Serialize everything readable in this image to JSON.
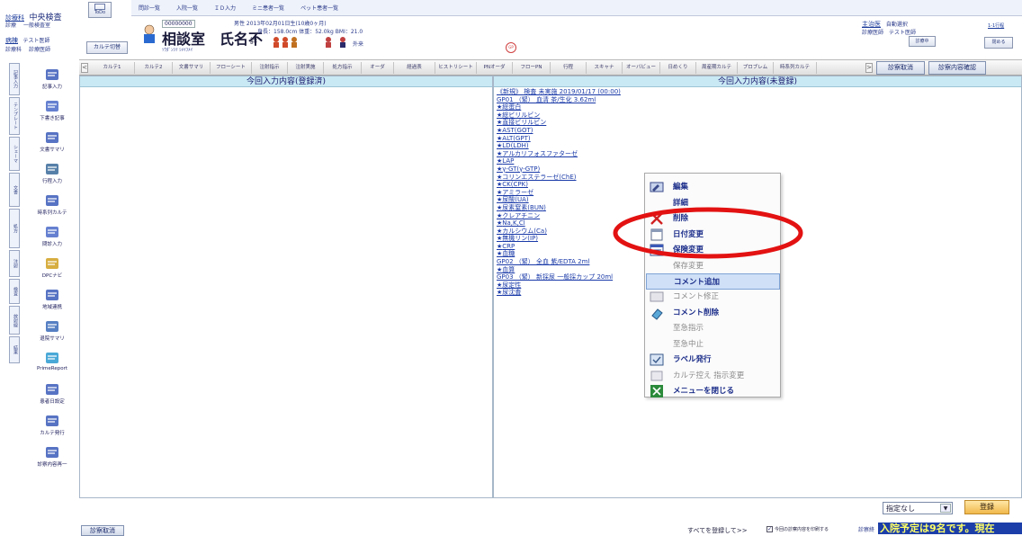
{
  "header": {
    "dept_label": "診療科",
    "dept_name": "中央検査",
    "dept_sub1": "診療",
    "dept_sub2": "一般検査室",
    "ward_label": "病棟",
    "ward_name": "テスト医師",
    "ward_sub": "診療科",
    "ward_sub2": "診療医師",
    "todo_label": "ToDo",
    "karte_switch": "カルテ切替",
    "menu_links": [
      "問診一覧",
      "入院一覧",
      "ＩＤ入力",
      "ミニ患者一覧",
      "ペット患者一覧"
    ],
    "attending_label": "主治医",
    "attending_value": "自動選択",
    "doctor_label": "診療医師",
    "doctor_value": "テスト医師",
    "link_right1": "1-1行程",
    "link_right2": "診療中",
    "link_right3": "閉める"
  },
  "patient": {
    "id": "00000000",
    "kana": "ｿｳﾀﾞﾝｼﾂ ｼﾒｲﾌﾒｲ",
    "name": "相談室　氏名不",
    "name_suffix": "詳",
    "info_line1": "男性 2013年02月01日生(10歳0ヶ月)",
    "info_line2": "身長：158.0cm  体重：52.0kg  BMI：21.0",
    "tag_inpatient": "外来"
  },
  "tabs": [
    "カルテ1",
    "カルテ2",
    "文書サマリ",
    "フローシート",
    "注射指示",
    "注射実施",
    "処方指示",
    "オーダ",
    "経過表",
    "ヒストリシート",
    "PNオーダ",
    "フローPN",
    "行程",
    "スキャナ",
    "オーバビュー",
    "日めくり",
    "周産期カルテ",
    "プロブレム",
    "時系列カルテ"
  ],
  "tab_buttons": {
    "cancel": "診察取消",
    "confirm": "診察内容確認"
  },
  "sidebar": {
    "vtabs": [
      "記事入力",
      "テンプレート",
      "シェーマ",
      "文書",
      "処方",
      "注射",
      "検査",
      "放射線",
      "結果"
    ],
    "items": [
      {
        "label": "記事入力",
        "icon": "pencil-icon"
      },
      {
        "label": "下書き記事",
        "icon": "draft-icon"
      },
      {
        "label": "文書サマリ",
        "icon": "document-icon"
      },
      {
        "label": "行程入力",
        "icon": "schedule-icon"
      },
      {
        "label": "時系列カルテ",
        "icon": "timeline-icon"
      },
      {
        "label": "問診入力",
        "icon": "interview-icon"
      },
      {
        "label": "DPCナビ",
        "icon": "dpc-icon"
      },
      {
        "label": "地域連携",
        "icon": "network-icon"
      },
      {
        "label": "退院サマリ",
        "icon": "summary-icon"
      },
      {
        "label": "PrimeReport",
        "icon": "report-icon"
      },
      {
        "label": "患者日設定",
        "icon": "calendar-icon"
      },
      {
        "label": "カルテ発行",
        "icon": "print-icon"
      },
      {
        "label": "診察内容再一",
        "icon": "review-icon"
      }
    ]
  },
  "panels": {
    "left_title": "今回入力内容(登録済)",
    "right_title": "今回入力内容(未登録)"
  },
  "order_list": [
    {
      "text": "《新規》 検査 未実施 2019/01/17 (00:00)",
      "star": false
    },
    {
      "text": "GP01 （緊） 血清 茶/生化 3.62ml",
      "star": false
    },
    {
      "text": "総蛋白",
      "star": true
    },
    {
      "text": "総ビリルビン",
      "star": true
    },
    {
      "text": "直接ビリルビン",
      "star": true
    },
    {
      "text": "AST(GOT)",
      "star": true
    },
    {
      "text": "ALT(GPT)",
      "star": true
    },
    {
      "text": "LD(LDH)",
      "star": true
    },
    {
      "text": "アルカリフォスファターゼ",
      "star": true
    },
    {
      "text": "LAP",
      "star": true
    },
    {
      "text": "γ-GT(γ-GTP)",
      "star": true
    },
    {
      "text": "コリンエステラーゼ(ChE)",
      "star": true
    },
    {
      "text": "CK(CPK)",
      "star": true
    },
    {
      "text": "アミラーゼ",
      "star": true
    },
    {
      "text": "尿酸(UA)",
      "star": true
    },
    {
      "text": "尿素窒素(BUN)",
      "star": true
    },
    {
      "text": "クレアチニン",
      "star": true
    },
    {
      "text": "Na,K,Cl",
      "star": true
    },
    {
      "text": "カルシウム(Ca)",
      "star": true
    },
    {
      "text": "無機リン(IP)",
      "star": true
    },
    {
      "text": "CRP",
      "star": true
    },
    {
      "text": "血糖",
      "star": true
    },
    {
      "text": "GP02 （緊） 全血 紫/EDTA 2ml",
      "star": false
    },
    {
      "text": "血算",
      "star": true
    },
    {
      "text": "GP03 （緊） 新採尿 一般採カップ 20ml",
      "star": false
    },
    {
      "text": "尿定性",
      "star": true
    },
    {
      "text": "尿沈査",
      "star": true
    }
  ],
  "context_menu": [
    {
      "label": "編集",
      "icon": "edit-icon",
      "enabled": true,
      "highlighted": false
    },
    {
      "label": "詳細",
      "icon": "",
      "enabled": true,
      "highlighted": false
    },
    {
      "label": "削除",
      "icon": "delete-x-icon",
      "enabled": true,
      "highlighted": false
    },
    {
      "label": "日付変更",
      "icon": "date-icon",
      "enabled": true,
      "highlighted": false
    },
    {
      "label": "保険変更",
      "icon": "insurance-icon",
      "enabled": true,
      "highlighted": false
    },
    {
      "label": "保存変更",
      "icon": "",
      "enabled": false,
      "highlighted": false
    },
    {
      "label": "コメント追加",
      "icon": "",
      "enabled": true,
      "highlighted": true
    },
    {
      "label": "コメント修正",
      "icon": "comment-edit-icon",
      "enabled": false,
      "highlighted": false
    },
    {
      "label": "コメント削除",
      "icon": "eraser-icon",
      "enabled": true,
      "highlighted": false
    },
    {
      "label": "至急指示",
      "icon": "",
      "enabled": false,
      "highlighted": false
    },
    {
      "label": "至急中止",
      "icon": "",
      "enabled": false,
      "highlighted": false
    },
    {
      "label": "ラベル発行",
      "icon": "label-icon",
      "enabled": true,
      "highlighted": false
    },
    {
      "label": "カルテ控え 指示変更",
      "icon": "copy-icon",
      "enabled": false,
      "highlighted": false
    },
    {
      "label": "メニューを閉じる",
      "icon": "close-menu-icon",
      "enabled": true,
      "highlighted": false
    }
  ],
  "bottom": {
    "cancel_button": "診察取消",
    "select_value": "指定なし",
    "register_button": "登録",
    "register_all": "すべてを登録して>>",
    "print_check": "今回の診察内容を印刷する",
    "consult_label": "診察終",
    "marquee": "入院予定は9名です。現在"
  },
  "colors": {
    "panel_head": "#c9e9f4",
    "highlight": "#cfe0f7",
    "annotation_red": "#e31212",
    "link_blue": "#1a3aa8"
  }
}
